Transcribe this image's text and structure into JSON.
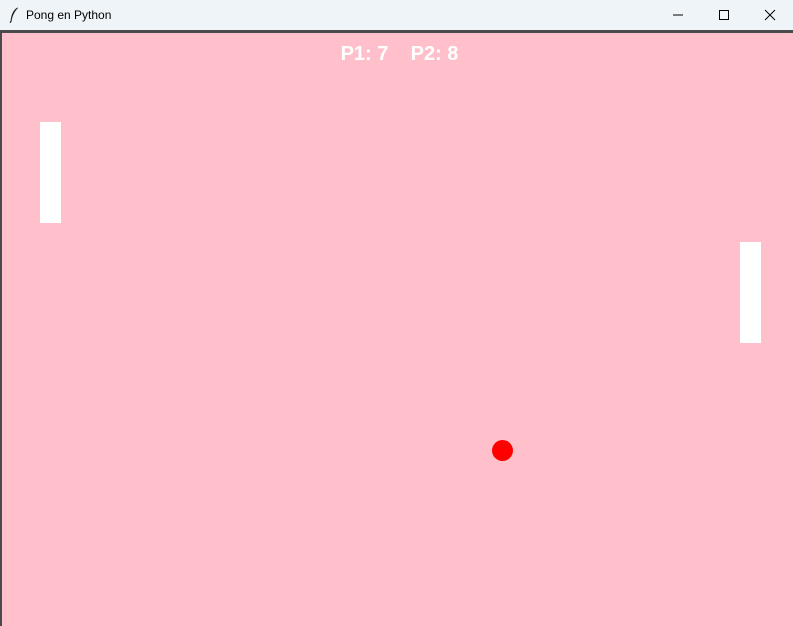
{
  "window": {
    "title": "Pong en Python",
    "app_icon": "feather-icon",
    "controls": [
      "minimize-icon",
      "maximize-icon",
      "close-icon"
    ]
  },
  "game": {
    "background_color": "#ffc0cb",
    "score": {
      "p1_label": "P1:",
      "p1_value": 7,
      "p2_label": "P2:",
      "p2_value": 8,
      "text": "P1: 7    P2: 8",
      "color": "#ffffff"
    },
    "paddle_color": "#ffffff",
    "ball_color": "#ff0000"
  }
}
